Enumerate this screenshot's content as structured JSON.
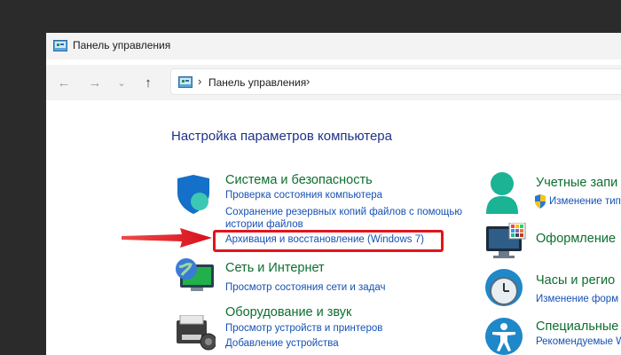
{
  "window": {
    "title": "Панель управления"
  },
  "navigation": {
    "back_icon": "←",
    "forward_icon": "→",
    "recent_icon": "⌄",
    "up_icon": "↑",
    "separator": "›",
    "breadcrumb": "Панель управления",
    "trailing_separator": "›"
  },
  "main": {
    "heading": "Настройка параметров компьютера",
    "categories": [
      {
        "title": "Система и безопасность",
        "links": [
          "Проверка состояния компьютера",
          "Сохранение резервных копий файлов с помощью истории файлов",
          "Архивация и восстановление (Windows 7)"
        ]
      },
      {
        "title": "Сеть и Интернет",
        "links": [
          "Просмотр состояния сети и задач"
        ]
      },
      {
        "title": "Оборудование и звук",
        "links": [
          "Просмотр устройств и принтеров",
          "Добавление устройства"
        ]
      },
      {
        "title": "Учетные запи",
        "links": [
          "Изменение типа"
        ]
      },
      {
        "title": "Оформление",
        "links": []
      },
      {
        "title": "Часы и регио",
        "links": [
          "Изменение форм"
        ]
      },
      {
        "title": "Специальные",
        "links": [
          "Рекомендуемые W"
        ]
      }
    ]
  },
  "colors": {
    "highlight": "#e0141c",
    "category_green": "#0c6e2e",
    "link_blue": "#1551b5",
    "heading_blue": "#1e3287"
  }
}
